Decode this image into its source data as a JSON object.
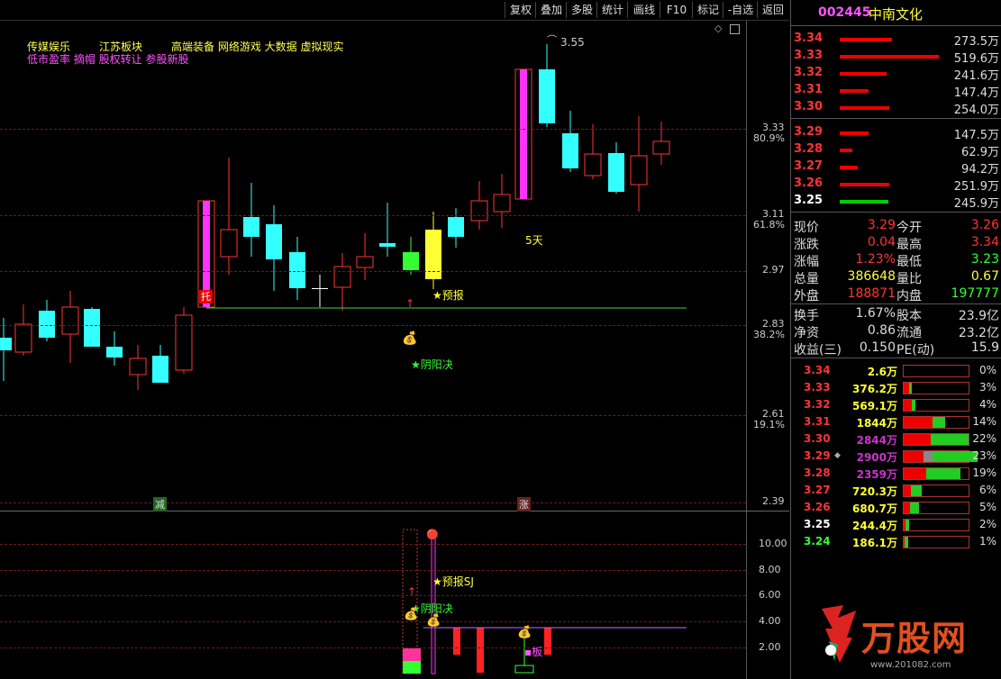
{
  "toolbar": {
    "buttons": [
      "复权",
      "叠加",
      "多股",
      "统计",
      "画线",
      "F10",
      "标记",
      "-自选",
      "返回"
    ]
  },
  "stock": {
    "code": "002445",
    "name": "中南文化"
  },
  "concepts": {
    "line1": [
      "传媒娱乐",
      "江苏板块",
      "高端装备 网络游戏 大数据 虚拟现实"
    ],
    "line2": "低市盈率 摘帽 股权转让 参股新股"
  },
  "annotations": {
    "high_price": "3.55",
    "tuo": "托",
    "yubao": "★预报",
    "yinyangjue": "★阴阳决",
    "five_days": "5天",
    "jian": "减",
    "zhang": "涨",
    "sub_yubao": "★预报SJ",
    "sub_yinyangjue": "★阴阳决",
    "sub_ban": "▪板"
  },
  "price_axis": [
    {
      "price": "3.33",
      "pct": "80.9%"
    },
    {
      "price": "3.11",
      "pct": "61.8%"
    },
    {
      "price": "2.97",
      "pct": ""
    },
    {
      "price": "2.83",
      "pct": "38.2%"
    },
    {
      "price": "2.61",
      "pct": "19.1%"
    },
    {
      "price": "2.39",
      "pct": ""
    }
  ],
  "sub_axis": [
    "10.00",
    "8.00",
    "6.00",
    "4.00",
    "2.00"
  ],
  "orderbook": {
    "asks": [
      {
        "price": "3.34",
        "vol": "273.5万",
        "len": 58
      },
      {
        "price": "3.33",
        "vol": "519.6万",
        "len": 110
      },
      {
        "price": "3.32",
        "vol": "241.6万",
        "len": 52
      },
      {
        "price": "3.31",
        "vol": "147.4万",
        "len": 32
      },
      {
        "price": "3.30",
        "vol": "254.0万",
        "len": 55
      }
    ],
    "bids": [
      {
        "price": "3.29",
        "vol": "147.5万",
        "len": 32,
        "color": "#ff3333",
        "bar": "#e00"
      },
      {
        "price": "3.28",
        "vol": "62.9万",
        "len": 14,
        "color": "#ff3333",
        "bar": "#e00"
      },
      {
        "price": "3.27",
        "vol": "94.2万",
        "len": 20,
        "color": "#ff3333",
        "bar": "#e00"
      },
      {
        "price": "3.26",
        "vol": "251.9万",
        "len": 55,
        "color": "#ff3333",
        "bar": "#e00"
      },
      {
        "price": "3.25",
        "vol": "245.9万",
        "len": 54,
        "color": "#ffffff",
        "bar": "#0c0"
      }
    ]
  },
  "quote": {
    "rows": [
      {
        "l1": "现价",
        "v1": "3.29",
        "c1": "#ff3333",
        "l2": "今开",
        "v2": "3.26",
        "c2": "#ff3333"
      },
      {
        "l1": "涨跌",
        "v1": "0.04",
        "c1": "#ff3333",
        "l2": "最高",
        "v2": "3.34",
        "c2": "#ff3333"
      },
      {
        "l1": "涨幅",
        "v1": "1.23%",
        "c1": "#ff3333",
        "l2": "最低",
        "v2": "3.23",
        "c2": "#33ff33"
      },
      {
        "l1": "总量",
        "v1": "386648",
        "c1": "#ffff33",
        "l2": "量比",
        "v2": "0.67",
        "c2": "#ffff33"
      },
      {
        "l1": "外盘",
        "v1": "188871",
        "c1": "#ff3333",
        "l2": "内盘",
        "v2": "197777",
        "c2": "#33ff33"
      }
    ],
    "rows2": [
      {
        "l1": "换手",
        "v1": "1.67%",
        "l2": "股本",
        "v2": "23.9亿"
      },
      {
        "l1": "净资",
        "v1": "0.86",
        "l2": "流通",
        "v2": "23.2亿"
      },
      {
        "l1": "收益(三)",
        "v1": "0.150",
        "l2": "PE(动)",
        "v2": "15.9"
      }
    ]
  },
  "volume_profile": [
    {
      "price": "3.34",
      "vol": "2.6万",
      "pct": "0%",
      "pc": "#ff3333",
      "vc": "#ffff33",
      "r": 0,
      "g": 0
    },
    {
      "price": "3.33",
      "vol": "376.2万",
      "pct": "3%",
      "pc": "#ff3333",
      "vc": "#ffff33",
      "r": 6,
      "g": 3
    },
    {
      "price": "3.32",
      "vol": "569.1万",
      "pct": "4%",
      "pc": "#ff3333",
      "vc": "#ffff33",
      "r": 9,
      "g": 4
    },
    {
      "price": "3.31",
      "vol": "1844万",
      "pct": "14%",
      "pc": "#ff3333",
      "vc": "#ffff33",
      "r": 32,
      "g": 14
    },
    {
      "price": "3.30",
      "vol": "2844万",
      "pct": "22%",
      "pc": "#ff3333",
      "vc": "#cc33cc",
      "r": 30,
      "g": 42
    },
    {
      "price": "3.29",
      "vol": "2900万",
      "pct": "23%",
      "pc": "#ff3333",
      "vc": "#cc33cc",
      "r": 22,
      "g": 50,
      "gray": 10,
      "mark": "◆"
    },
    {
      "price": "3.28",
      "vol": "2359万",
      "pct": "19%",
      "pc": "#ff3333",
      "vc": "#cc33cc",
      "r": 25,
      "g": 38
    },
    {
      "price": "3.27",
      "vol": "720.3万",
      "pct": "6%",
      "pc": "#ff3333",
      "vc": "#ffff33",
      "r": 8,
      "g": 12
    },
    {
      "price": "3.26",
      "vol": "680.7万",
      "pct": "5%",
      "pc": "#ff3333",
      "vc": "#ffff33",
      "r": 7,
      "g": 10
    },
    {
      "price": "3.25",
      "vol": "244.4万",
      "pct": "2%",
      "pc": "#ffffff",
      "vc": "#ffff33",
      "r": 2,
      "g": 4
    },
    {
      "price": "3.24",
      "vol": "186.1万",
      "pct": "1%",
      "pc": "#33ff33",
      "vc": "#ffff33",
      "r": 1,
      "g": 4
    }
  ],
  "logo": {
    "text": "万股网",
    "url": "www.201082.com"
  }
}
